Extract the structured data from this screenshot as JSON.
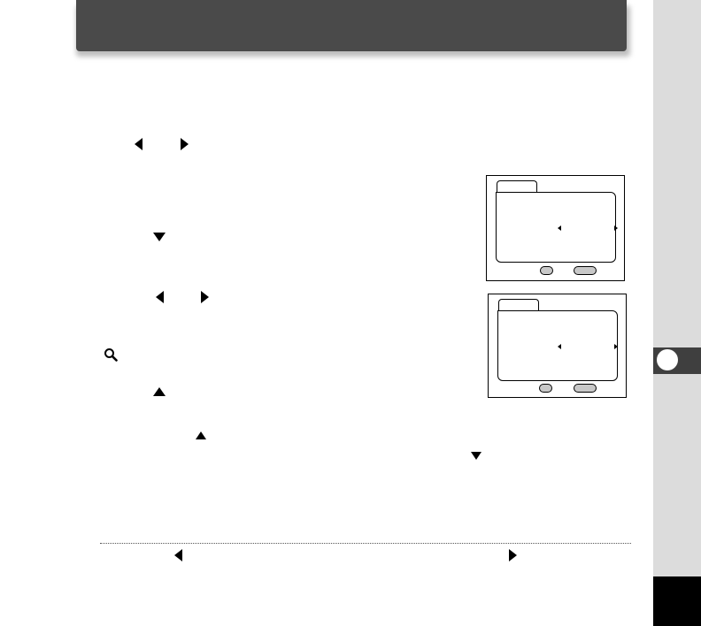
{
  "header": {
    "background_color": "#4a4a4a"
  },
  "side": {
    "strip_color": "#dcdcdc",
    "tab_color": "#3f3f3f",
    "page_box_color": "#000000"
  },
  "icons": [
    "left-arrow-icon",
    "right-arrow-icon",
    "down-arrow-icon",
    "left-arrow-icon",
    "right-arrow-icon",
    "magnifier-icon",
    "up-arrow-icon",
    "up-arrow-icon",
    "down-arrow-icon",
    "left-arrow-icon",
    "right-arrow-icon"
  ],
  "screens": [
    {
      "name": "lcd-screen-1",
      "has_tab": true,
      "has_left_right_arrows": true,
      "buttons": 2
    },
    {
      "name": "lcd-screen-2",
      "has_tab": true,
      "has_left_right_arrows": true,
      "buttons": 2
    }
  ]
}
